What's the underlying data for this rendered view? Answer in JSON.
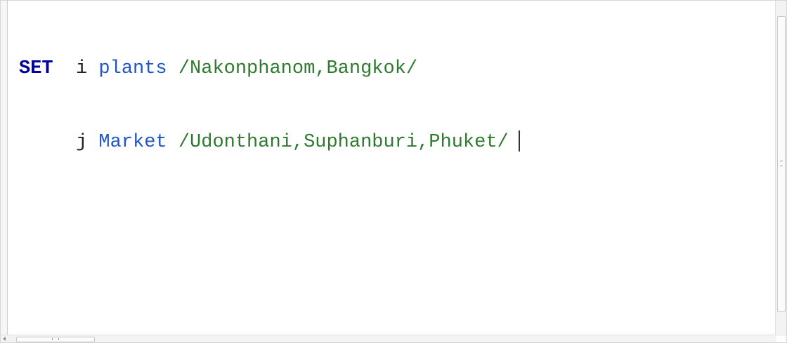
{
  "editor": {
    "lines": [
      {
        "keyword": "SET",
        "gap1": "  ",
        "index": "i",
        "gap2": " ",
        "set_name": "plants",
        "gap3": " ",
        "elements": "/Nakonphanom,Bangkok/"
      },
      {
        "keyword": "",
        "gap1": "     ",
        "index": "j",
        "gap2": " ",
        "set_name": "Market",
        "gap3": " ",
        "elements": "/Udonthani,Suphanburi,Phuket/"
      }
    ]
  },
  "colors": {
    "keyword": "#0000a0",
    "identifier": "#1f55c8",
    "elements": "#2f7a2f",
    "plain": "#222222"
  }
}
